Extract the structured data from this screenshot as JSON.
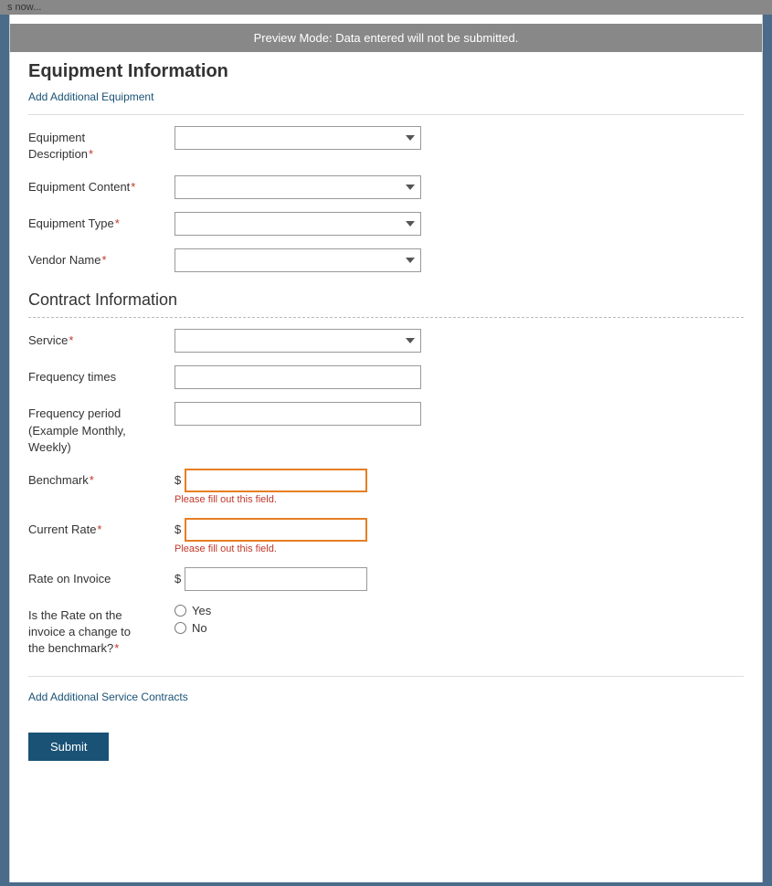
{
  "topbar": {
    "text": "s now..."
  },
  "preview_banner": "Preview Mode: Data entered will not be submitted.",
  "equipment_section": {
    "title": "Equipment Information",
    "add_equipment_link": "Add Additional Equipment",
    "fields": [
      {
        "label": "Equipment Description",
        "required": true,
        "type": "select",
        "name": "equipment-description"
      },
      {
        "label": "Equipment Content",
        "required": true,
        "type": "select",
        "name": "equipment-content"
      },
      {
        "label": "Equipment Type",
        "required": true,
        "type": "select",
        "name": "equipment-type"
      },
      {
        "label": "Vendor Name",
        "required": true,
        "type": "select",
        "name": "vendor-name"
      }
    ]
  },
  "contract_section": {
    "title": "Contract Information",
    "fields": [
      {
        "label": "Service",
        "required": true,
        "type": "select",
        "name": "service"
      },
      {
        "label": "Frequency times",
        "required": false,
        "type": "text",
        "name": "frequency-times"
      },
      {
        "label": "Frequency period\n(Example Monthly,\nWeekly)",
        "label_line1": "Frequency period",
        "label_line2": "(Example Monthly,",
        "label_line3": "Weekly)",
        "required": false,
        "type": "text",
        "name": "frequency-period"
      }
    ],
    "benchmark": {
      "label": "Benchmark",
      "required": true,
      "dollar_sign": "$",
      "error": "Please fill out this field.",
      "name": "benchmark"
    },
    "current_rate": {
      "label": "Current Rate",
      "required": true,
      "dollar_sign": "$",
      "error": "Please fill out this field.",
      "name": "current-rate"
    },
    "rate_on_invoice": {
      "label": "Rate on Invoice",
      "dollar_sign": "$",
      "name": "rate-on-invoice"
    },
    "rate_change": {
      "label_line1": "Is the Rate on the",
      "label_line2": "invoice a change to",
      "label_line3": "the benchmark?",
      "required": true,
      "options": [
        "Yes",
        "No"
      ],
      "name": "rate-change"
    }
  },
  "add_service_contracts_link": "Add Additional Service Contracts",
  "submit_button": "Submit"
}
